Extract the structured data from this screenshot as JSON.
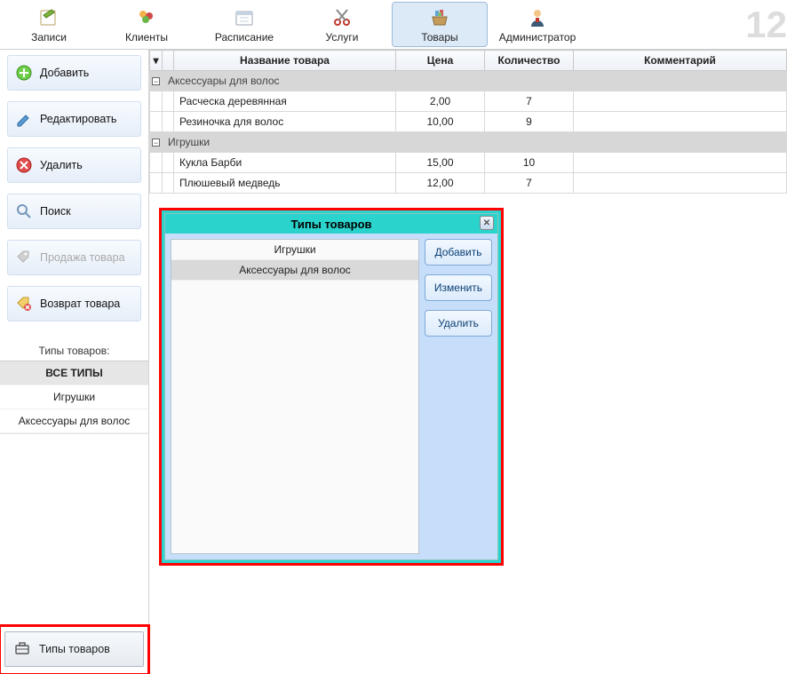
{
  "big_number": "12",
  "toolbar": [
    {
      "id": "records",
      "label": "Записи",
      "icon": "pencil",
      "active": false
    },
    {
      "id": "clients",
      "label": "Клиенты",
      "icon": "people",
      "active": false
    },
    {
      "id": "schedule",
      "label": "Расписание",
      "icon": "calendar",
      "active": false
    },
    {
      "id": "services",
      "label": "Услуги",
      "icon": "scissors",
      "active": false
    },
    {
      "id": "products",
      "label": "Товары",
      "icon": "basket",
      "active": true
    },
    {
      "id": "admin",
      "label": "Администратор",
      "icon": "person",
      "active": false
    }
  ],
  "side_buttons": [
    {
      "id": "add",
      "label": "Добавить",
      "icon": "plus-green",
      "disabled": false
    },
    {
      "id": "edit",
      "label": "Редактировать",
      "icon": "pencil-blue",
      "disabled": false
    },
    {
      "id": "delete",
      "label": "Удалить",
      "icon": "x-red",
      "disabled": false
    },
    {
      "id": "search",
      "label": "Поиск",
      "icon": "lens",
      "disabled": false
    },
    {
      "id": "sale",
      "label": "Продажа товара",
      "icon": "tag",
      "disabled": true
    },
    {
      "id": "return",
      "label": "Возврат товара",
      "icon": "tag-x",
      "disabled": false
    }
  ],
  "types_section_label": "Типы товаров:",
  "types_side": {
    "all_label": "ВСЕ ТИПЫ",
    "items": [
      "Игрушки",
      "Аксессуары для волос"
    ]
  },
  "bottom_button_label": "Типы товаров",
  "grid": {
    "headers": {
      "name": "Название товара",
      "price": "Цена",
      "qty": "Количество",
      "comment": "Комментарий"
    },
    "groups": [
      {
        "title": "Аксессуары для волос",
        "rows": [
          {
            "name": "Расческа деревянная",
            "price": "2,00",
            "qty": "7",
            "comment": ""
          },
          {
            "name": "Резиночка для волос",
            "price": "10,00",
            "qty": "9",
            "comment": ""
          }
        ]
      },
      {
        "title": "Игрушки",
        "rows": [
          {
            "name": "Кукла Барби",
            "price": "15,00",
            "qty": "10",
            "comment": ""
          },
          {
            "name": "Плюшевый медведь",
            "price": "12,00",
            "qty": "7",
            "comment": ""
          }
        ]
      }
    ]
  },
  "dialog": {
    "title": "Типы товаров",
    "items": [
      {
        "label": "Игрушки",
        "selected": false
      },
      {
        "label": "Аксессуары для волос",
        "selected": true
      }
    ],
    "buttons": {
      "add": "Добавить",
      "edit": "Изменить",
      "delete": "Удалить"
    }
  }
}
